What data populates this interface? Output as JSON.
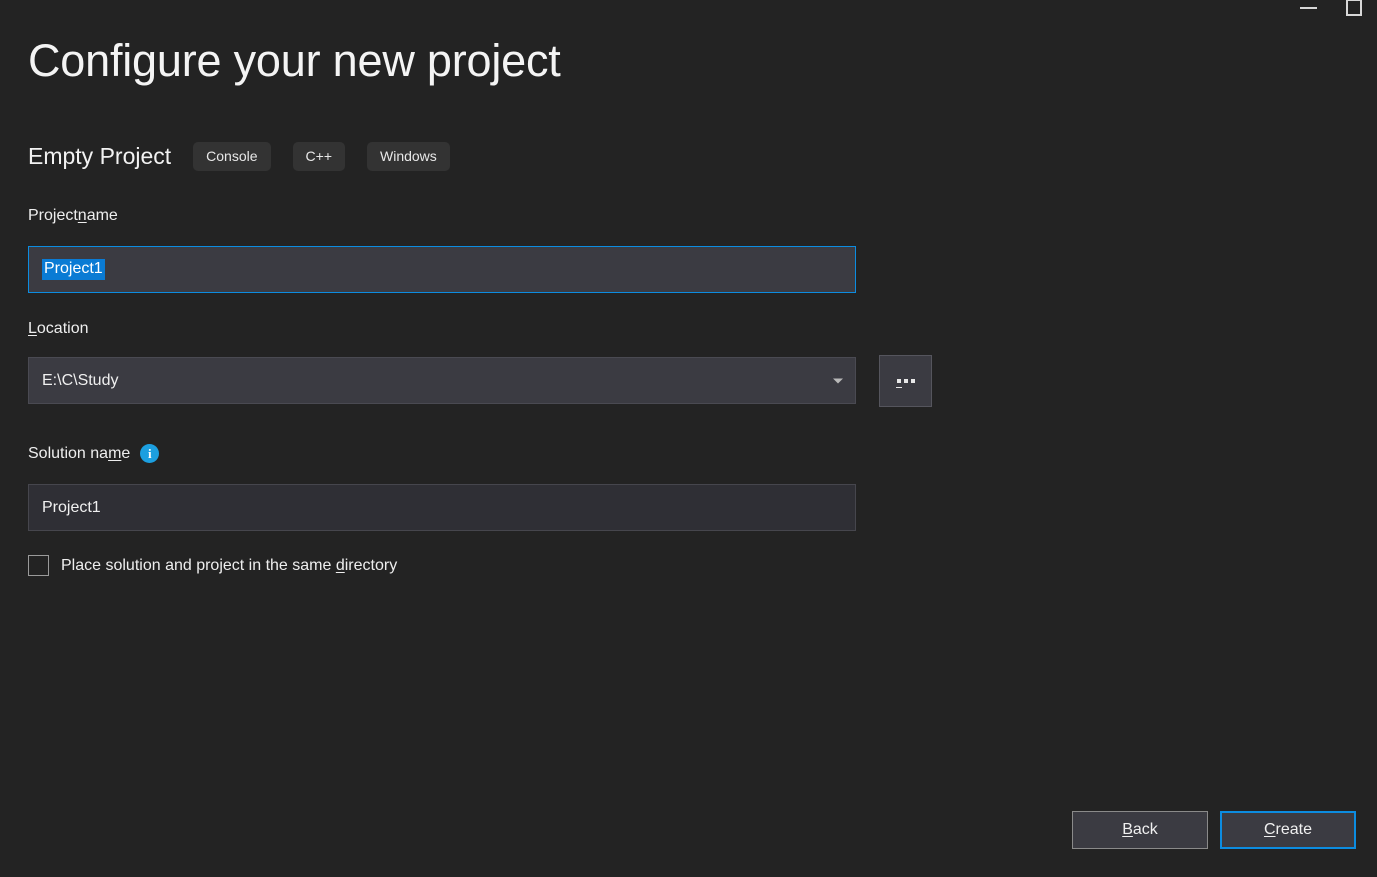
{
  "window": {
    "minimize_label": "Minimize",
    "maximize_label": "Maximize"
  },
  "header": {
    "title": "Configure your new project",
    "template_name": "Empty Project",
    "tags": [
      "Console",
      "C++",
      "Windows"
    ]
  },
  "form": {
    "project_name": {
      "label_before": "Project ",
      "label_accesskey": "n",
      "label_after": "ame",
      "value": "Project1",
      "selected": true
    },
    "location": {
      "label_accesskey": "L",
      "label_after": "ocation",
      "value": "E:\\C\\Study",
      "browse_button_label": "..."
    },
    "solution_name": {
      "label_before": "Solution na",
      "label_accesskey": "m",
      "label_after": "e",
      "value": "Project1",
      "info_icon": "info-icon",
      "info_glyph": "i"
    },
    "same_directory_checkbox": {
      "label_before": "Place solution and project in the same ",
      "label_accesskey": "d",
      "label_after": "irectory",
      "checked": false
    }
  },
  "footer": {
    "back_before": "",
    "back_accesskey": "B",
    "back_after": "ack",
    "create_before": "",
    "create_accesskey": "C",
    "create_after": "reate"
  },
  "colors": {
    "background": "#232323",
    "accent_blue": "#0c8ce0",
    "selection_blue": "#0a7bd4",
    "input_background": "#3b3b42",
    "tag_background": "#333333",
    "info_blue": "#1c9fe0"
  }
}
